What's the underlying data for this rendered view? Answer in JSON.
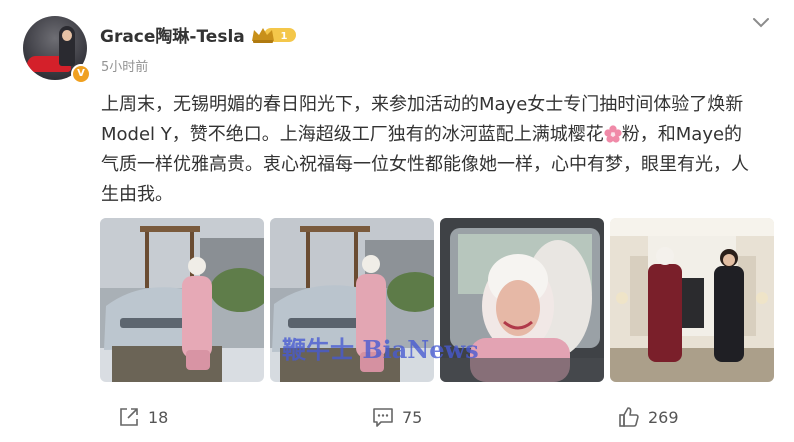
{
  "post": {
    "username": "Grace陶琳-Tesla",
    "level_badge": "1",
    "verified_mark": "V",
    "timestamp": "5小时前",
    "text_line1": "上周末，无锡明媚的春日阳光下，来参加活动的Maye女士专门抽时间体验了焕新",
    "text_line2": "Model Y，赞不绝口。上海超级工厂独有的冰河蓝配上满城樱花",
    "text_line2b": "粉，和Maye的",
    "text_line3": "气质一样优雅高贵。衷心祝福每一位女性都能像她一样，心中有梦，眼里有光，人",
    "text_line4": "生由我。"
  },
  "icons": {
    "avatar": "avatar",
    "verified": "verified-v-badge",
    "level": "crown-level-badge",
    "menu": "chevron-down-icon",
    "emoji": "cherry-blossom-icon",
    "share": "share-icon",
    "comment": "comment-icon",
    "like": "thumbs-up-icon"
  },
  "watermark": "鞭牛士 BiaNews",
  "actions": {
    "share_count": "18",
    "comment_count": "75",
    "like_count": "269"
  },
  "colors": {
    "text": "#333333",
    "meta": "#939393",
    "badge_gold": "#f0a020",
    "blossom_pink": "#f08aa8",
    "watermark_blue": "#4a5ad2"
  }
}
